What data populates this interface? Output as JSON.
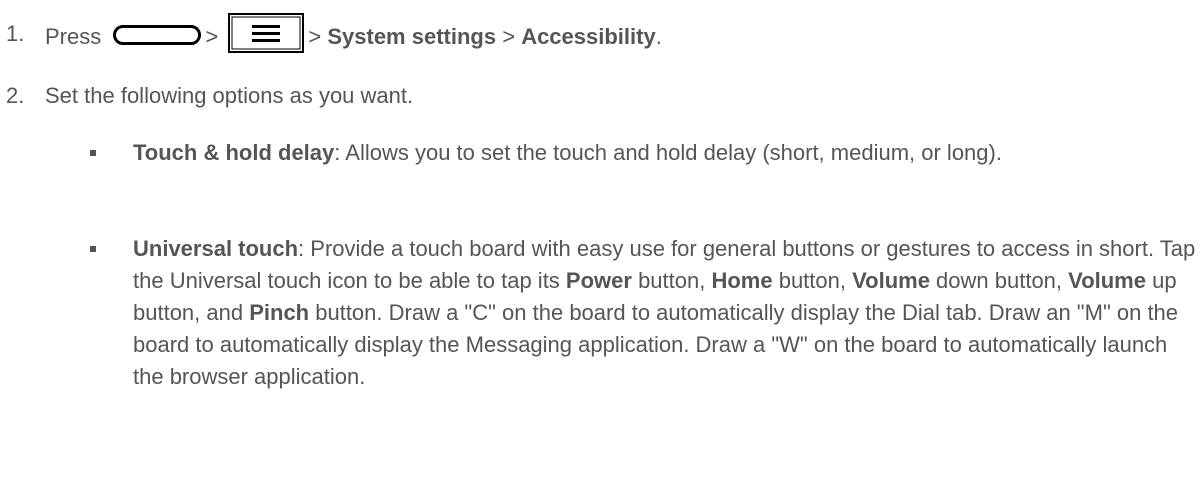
{
  "step1": {
    "number": "1.",
    "press": "Press",
    "home_key_icon": "home-key-icon",
    "sep1": ">",
    "menu_key_icon": "menu-key-icon",
    "sep2": ">",
    "system_settings": "System settings",
    "sep3": ">",
    "accessibility": "Accessibility",
    "period": "."
  },
  "step2": {
    "number": "2.",
    "text": "Set the following options as you want."
  },
  "bullets": [
    {
      "term": "Touch & hold delay",
      "desc": ": Allows you to set the touch and hold delay (short, medium, or long)."
    },
    {
      "term": "Universal touch",
      "desc_1": ": Provide a touch board with easy use for general buttons or gestures to access in short. Tap the Universal touch icon to be able to tap its ",
      "power": "Power",
      "desc_2": " button, ",
      "home": "Home",
      "desc_3": " button, ",
      "volume_down": "Volume",
      "desc_4": " down button, ",
      "volume_up": "Volume",
      "desc_5": " up button, and ",
      "pinch": "Pinch",
      "desc_6": " button. Draw a \"C\" on the board to automatically display the Dial tab. Draw an \"M\" on the board to automatically display the Messaging application. Draw a \"W\" on the board to automatically launch the browser application."
    }
  ],
  "colors": {
    "text": "#555555",
    "icon_stroke": "#000000"
  }
}
